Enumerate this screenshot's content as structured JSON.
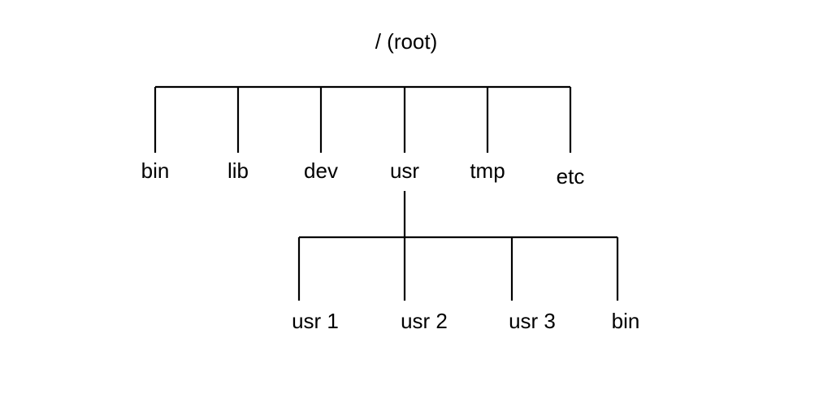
{
  "tree": {
    "root_label": "/ (root)",
    "level1": {
      "items": [
        {
          "name": "bin"
        },
        {
          "name": "lib"
        },
        {
          "name": "dev"
        },
        {
          "name": "usr"
        },
        {
          "name": "tmp"
        },
        {
          "name": "etc"
        }
      ]
    },
    "usr_children": {
      "items": [
        {
          "name": "usr 1"
        },
        {
          "name": "usr 2"
        },
        {
          "name": "usr 3"
        },
        {
          "name": "bin"
        }
      ]
    }
  }
}
